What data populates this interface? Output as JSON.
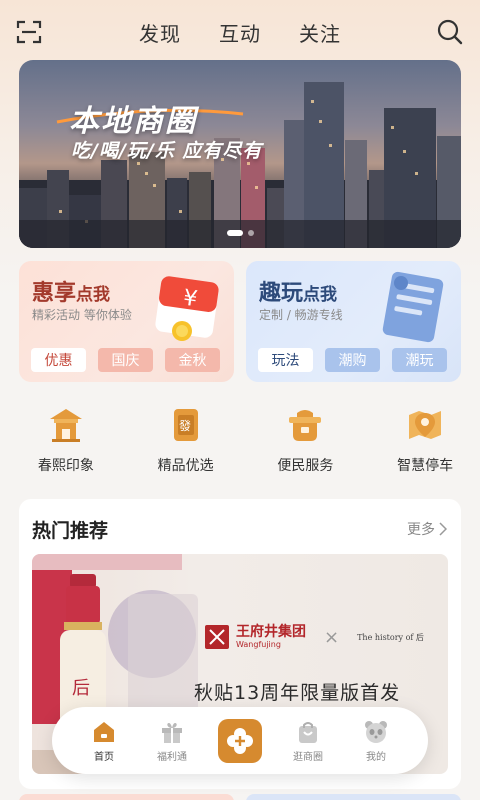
{
  "header": {
    "tabs": [
      "发现",
      "互动",
      "关注"
    ]
  },
  "banner": {
    "title": "本地商圈",
    "subtitle": "吃/喝/玩/乐 应有尽有"
  },
  "promos": [
    {
      "title_big": "惠享",
      "title_small": "点我",
      "subtitle": "精彩活动 等你体验",
      "chips": [
        "优惠",
        "国庆",
        "金秋"
      ]
    },
    {
      "title_big": "趣玩",
      "title_small": "点我",
      "subtitle": "定制 / 畅游专线",
      "chips": [
        "玩法",
        "潮购",
        "潮玩"
      ]
    }
  ],
  "services": [
    {
      "label": "春熙印象",
      "icon": "pavilion-icon"
    },
    {
      "label": "精品优选",
      "icon": "fortune-bag-icon"
    },
    {
      "label": "便民服务",
      "icon": "service-pot-icon"
    },
    {
      "label": "智慧停车",
      "icon": "parking-location-icon"
    }
  ],
  "hot": {
    "title": "热门推荐",
    "more": "更多",
    "brand_cn": "王府井集团",
    "brand_en": "Wangfujing",
    "brand_x": "×",
    "partner": "The history of 后",
    "caption": "秋贴13周年限量版首发"
  },
  "nav": {
    "items": [
      "首页",
      "福利通",
      "",
      "逛商圈",
      "我的"
    ]
  },
  "colors": {
    "accent": "#d68a2f",
    "promo_left_text": "#a33a2c",
    "promo_right_text": "#2d4a7a"
  }
}
